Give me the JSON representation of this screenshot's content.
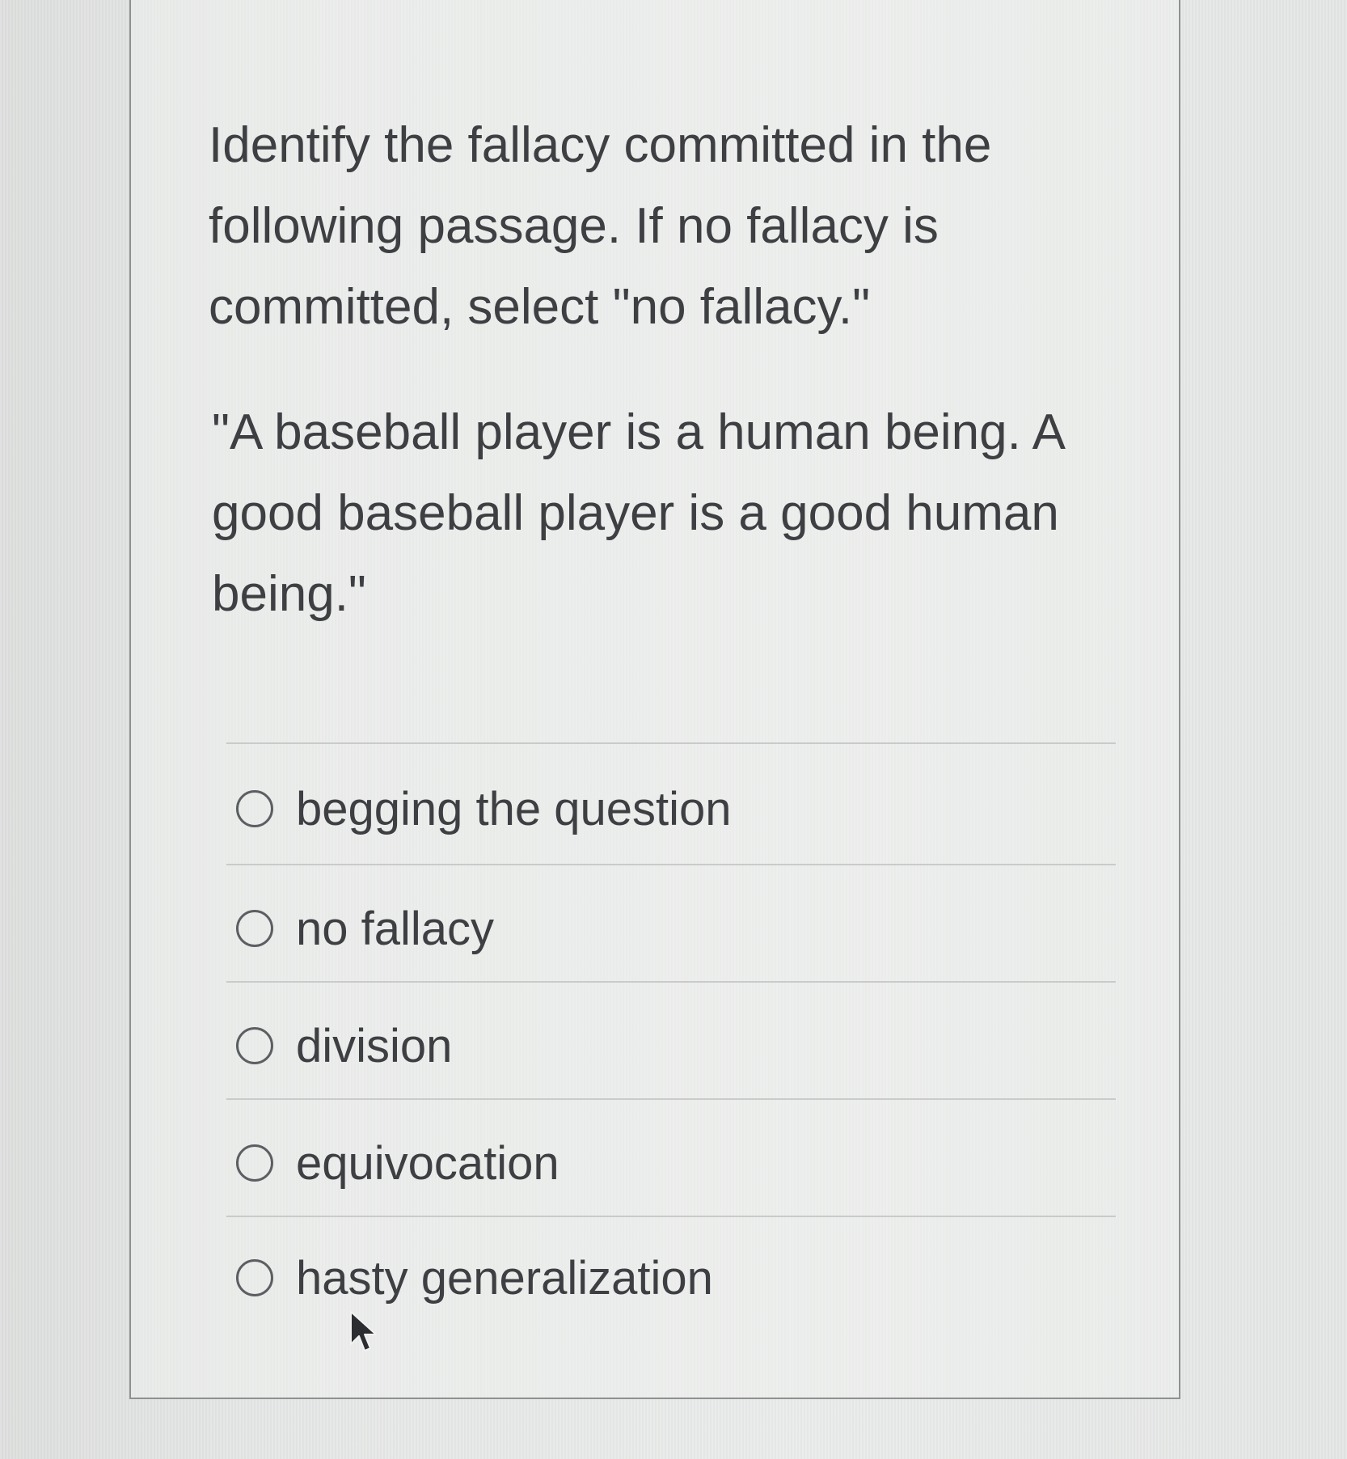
{
  "question": {
    "prompt": "Identify the fallacy committed in the following passage. If no fallacy is committed, select \"no fallacy.\"",
    "passage": "\"A baseball player is a human being. A good baseball player is a good human being.\""
  },
  "options": [
    {
      "label": "begging the question",
      "selected": false
    },
    {
      "label": "no fallacy",
      "selected": false
    },
    {
      "label": "division",
      "selected": false
    },
    {
      "label": "equivocation",
      "selected": false
    },
    {
      "label": "hasty generalization",
      "selected": false
    }
  ],
  "icons": {
    "radio": "radio-unselected-icon",
    "cursor": "mouse-pointer-icon"
  },
  "colors": {
    "text": "#3d3f42",
    "border": "#8e9190",
    "radio": "#5c5f62",
    "divider": "#c9cbca"
  }
}
